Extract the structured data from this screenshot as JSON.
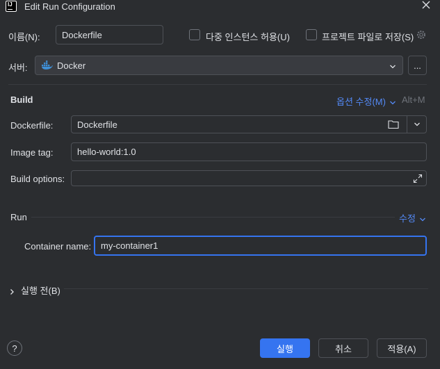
{
  "window": {
    "title": "Edit Run Configuration",
    "app_icon_text": "IJ"
  },
  "name_row": {
    "label": "이름(N):",
    "value": "Dockerfile",
    "allow_parallel_label": "다중 인스턴스 허용(U)",
    "store_as_file_label": "프로젝트 파일로 저장(S)"
  },
  "server_row": {
    "label": "서버:",
    "value": "Docker",
    "more_button": "..."
  },
  "build": {
    "heading": "Build",
    "modify_options_label": "옵션 수정(M)",
    "modify_shortcut": "Alt+M",
    "dockerfile_label": "Dockerfile:",
    "dockerfile_value": "Dockerfile",
    "image_tag_label": "Image tag:",
    "image_tag_value": "hello-world:1.0",
    "build_options_label": "Build options:",
    "build_options_value": ""
  },
  "run": {
    "heading": "Run",
    "modify_label": "수정",
    "container_name_label": "Container name:",
    "container_name_value": "my-container1"
  },
  "before_launch": {
    "label": "실행 전(B)"
  },
  "footer": {
    "help_label": "?",
    "run_button": "실행",
    "cancel_button": "취소",
    "apply_button": "적용(A)"
  },
  "colors": {
    "background": "#2b2d30",
    "accent": "#3574f0",
    "link": "#548af7"
  },
  "icons": [
    "app-icon",
    "close-icon",
    "docker-icon",
    "chevron-down-icon",
    "gear-icon",
    "folder-icon",
    "expand-icon",
    "chevron-right-icon",
    "help-icon"
  ]
}
